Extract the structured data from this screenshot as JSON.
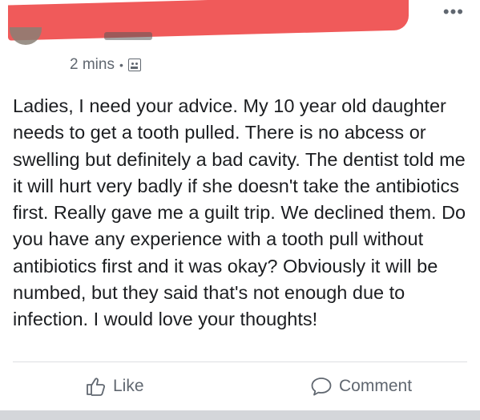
{
  "post": {
    "timestamp": "2 mins",
    "separator": "•",
    "audience_icon": "group-icon",
    "text": "Ladies, I need your advice.  My 10 year old daughter needs to get a tooth pulled. There is no abcess or swelling but definitely a bad cavity. The dentist told me it will hurt very badly if she doesn't take the antibiotics first. Really gave me a guilt trip. We declined them. Do you have any experience with a tooth pull without antibiotics first and it was okay? Obviously it will be numbed, but they said that's not enough due to infection. I would love your thoughts!"
  },
  "header": {
    "more_icon": "more-options-icon",
    "more_glyph": "•••"
  },
  "actions": {
    "like_label": "Like",
    "comment_label": "Comment"
  },
  "colors": {
    "redaction": "#f05a5a",
    "meta_text": "#606770",
    "body_text": "#1c1e21"
  }
}
